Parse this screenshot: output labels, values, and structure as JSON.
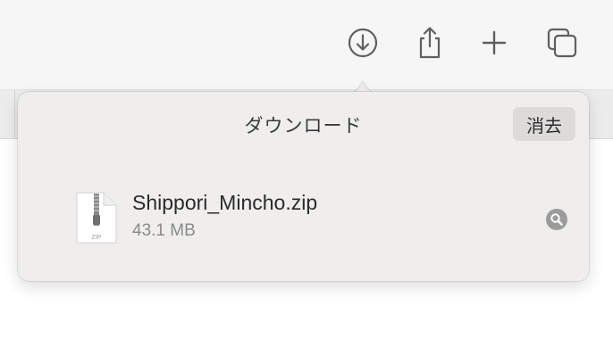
{
  "toolbar": {
    "buttons": [
      {
        "name": "downloads",
        "icon": "arrow-down-circle-icon"
      },
      {
        "name": "share",
        "icon": "share-icon"
      },
      {
        "name": "new-tab",
        "icon": "plus-icon"
      },
      {
        "name": "tab-overview",
        "icon": "tab-overview-icon"
      }
    ]
  },
  "downloads_popover": {
    "title": "ダウンロード",
    "clear_label": "消去",
    "items": [
      {
        "file_name": "Shippori_Mincho.zip",
        "file_size": "43.1 MB",
        "file_type_label": "ZIP",
        "reveal_icon": "magnifier-icon"
      }
    ]
  },
  "colors": {
    "toolbar_bg": "#f6f6f6",
    "popover_bg": "#efeeed",
    "icon_gray": "#5f5f5f",
    "clear_button_bg": "#dcdbda",
    "secondary_text": "#8a8a8a"
  }
}
